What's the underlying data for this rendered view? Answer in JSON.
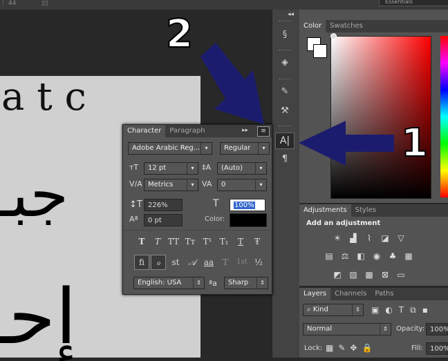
{
  "topbar": {
    "icon1": "⋮ 44",
    "icon2": "▯▯",
    "workspace": "Essentials"
  },
  "document": {
    "latin_text": "a t c",
    "arabic_line1": "جبـ",
    "arabic_line2": "إحـ"
  },
  "dock": {
    "collapse": "◂◂",
    "icons": [
      "paragraph-styles-icon",
      "3d-icon",
      "brushes-icon",
      "tool-presets-icon",
      "character-icon",
      "paragraph-icon"
    ]
  },
  "color_panel": {
    "tabs": [
      "Color",
      "Swatches"
    ],
    "active_tab": "Color",
    "foreground": "#ffffff",
    "background": "#ffffff"
  },
  "adjustments_panel": {
    "tabs": [
      "Adjustments",
      "Styles"
    ],
    "title": "Add an adjustment"
  },
  "layers_panel": {
    "tabs": [
      "Layers",
      "Channels",
      "Paths"
    ],
    "kind_label": "Kind",
    "blend_mode": "Normal",
    "opacity_label": "Opacity:",
    "opacity_value": "100%",
    "lock_label": "Lock:",
    "fill_label": "Fill:",
    "fill_value": "100%"
  },
  "character_panel": {
    "tabs": [
      "Character",
      "Paragraph"
    ],
    "font_family": "Adobe Arabic Reg...",
    "font_style": "Regular",
    "font_size": "12 pt",
    "leading": "(Auto)",
    "kerning": "Metrics",
    "tracking": "0",
    "vertical_scale": "226%",
    "horizontal_scale": "100%",
    "baseline_shift": "0 pt",
    "color_label": "Color:",
    "color_value": "#000000",
    "style_buttons": [
      "T",
      "T",
      "TT",
      "Tт",
      "T¹",
      "T₁",
      "T",
      "Ŧ"
    ],
    "opentype_buttons": [
      "fi",
      "ℴ",
      "st",
      "𝒜",
      "aa",
      "𝕋",
      "1st",
      "½"
    ],
    "language": "English: USA",
    "aa_symbol": "ªa",
    "antialias": "Sharp"
  },
  "annotations": {
    "label1": "1",
    "label2": "2"
  }
}
